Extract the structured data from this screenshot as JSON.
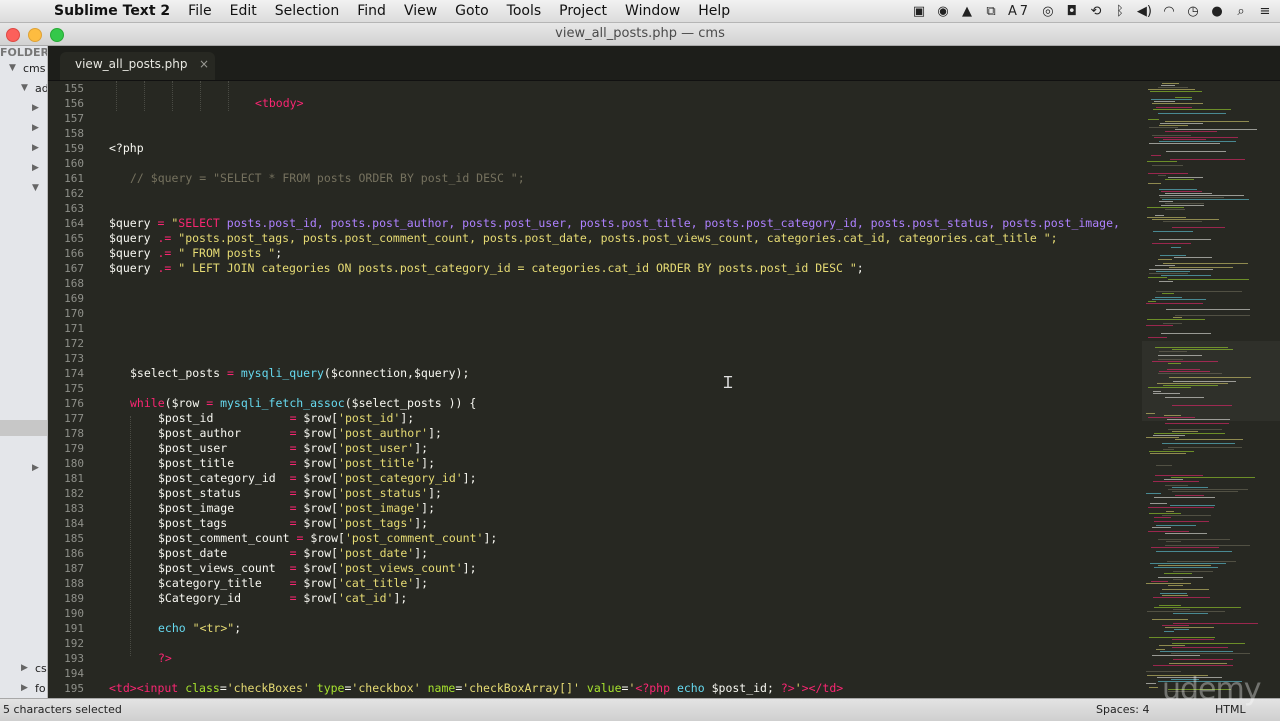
{
  "menubar": {
    "app_name": "Sublime Text 2",
    "items": [
      "File",
      "Edit",
      "Selection",
      "Find",
      "View",
      "Goto",
      "Tools",
      "Project",
      "Window",
      "Help"
    ],
    "tray_icons": [
      "screen-icon",
      "record-icon",
      "drive-icon",
      "share-icon",
      "adobe-icon",
      "cc-icon",
      "cam-icon",
      "timemachine-icon",
      "bluetooth-icon",
      "volume-icon",
      "wifi-icon",
      "clock-icon",
      "user-icon",
      "search-icon",
      "list-icon"
    ],
    "tray_text": "7"
  },
  "window": {
    "title": "view_all_posts.php — cms"
  },
  "sidebar": {
    "heading": "FOLDER",
    "rows": [
      {
        "label": "cms"
      },
      {
        "label": "ad"
      },
      {
        "label": ""
      },
      {
        "label": ""
      },
      {
        "label": ""
      },
      {
        "label": ""
      },
      {
        "label": ""
      },
      {
        "label": "cs"
      },
      {
        "label": "fo"
      }
    ]
  },
  "tab": {
    "label": "view_all_posts.php",
    "close": "×"
  },
  "editor": {
    "lines": [
      {
        "n": "155"
      },
      {
        "n": "156"
      },
      {
        "n": "157"
      },
      {
        "n": "158"
      },
      {
        "n": "159"
      },
      {
        "n": "160"
      },
      {
        "n": "161"
      },
      {
        "n": "162"
      },
      {
        "n": "163"
      },
      {
        "n": "164"
      },
      {
        "n": "165"
      },
      {
        "n": "166"
      },
      {
        "n": "167"
      },
      {
        "n": "168"
      },
      {
        "n": "169"
      },
      {
        "n": "170"
      },
      {
        "n": "171"
      },
      {
        "n": "172"
      },
      {
        "n": "173"
      },
      {
        "n": "174"
      },
      {
        "n": "175"
      },
      {
        "n": "176"
      },
      {
        "n": "177"
      },
      {
        "n": "178"
      },
      {
        "n": "179"
      },
      {
        "n": "180"
      },
      {
        "n": "181"
      },
      {
        "n": "182"
      },
      {
        "n": "183"
      },
      {
        "n": "184"
      },
      {
        "n": "185"
      },
      {
        "n": "186"
      },
      {
        "n": "187"
      },
      {
        "n": "188"
      },
      {
        "n": "189"
      },
      {
        "n": "190"
      },
      {
        "n": "191"
      },
      {
        "n": "192"
      },
      {
        "n": "193"
      },
      {
        "n": "194"
      },
      {
        "n": "195"
      }
    ],
    "code": {
      "l156": "<tbody>",
      "l159": "<?php",
      "l161": "// $query = \"SELECT * FROM posts ORDER BY post_id DESC \";",
      "l164": "$query = \"SELECT posts.post_id, posts.post_author, posts.post_user, posts.post_title, posts.post_category_id, posts.post_status, posts.post_image, ",
      "l165": "$query .= \"posts.post_tags, posts.post_comment_count, posts.post_date, posts.post_views_count, categories.cat_id, categories.cat_title \";",
      "l166": "$query .= \" FROM posts \";",
      "l167": "$query .= \" LEFT JOIN categories ON posts.post_category_id = categories.cat_id ORDER BY posts.post_id DESC \";",
      "l174": "$select_posts = mysqli_query($connection,$query);",
      "l176": "while($row = mysqli_fetch_assoc($select_posts )) {",
      "l177": "$post_id           = $row['post_id'];",
      "l178": "$post_author       = $row['post_author'];",
      "l179": "$post_user         = $row['post_user'];",
      "l180": "$post_title        = $row['post_title'];",
      "l181": "$post_category_id  = $row['post_category_id'];",
      "l182": "$post_status       = $row['post_status'];",
      "l183": "$post_image        = $row['post_image'];",
      "l184": "$post_tags         = $row['post_tags'];",
      "l185": "$post_comment_count = $row['post_comment_count'];",
      "l186": "$post_date         = $row['post_date'];",
      "l187": "$post_views_count  = $row['post_views_count'];",
      "l188": "$category_title    = $row['cat_title'];",
      "l189": "$Category_id       = $row['cat_id'];",
      "l191": "echo \"<tr>\";",
      "l193": "?>",
      "l195": "<td><input class='checkBoxes' type='checkbox' name='checkBoxArray[]' value='<?php echo $post_id; ?>'></td>"
    }
  },
  "statusbar": {
    "selection": "5 characters selected",
    "spaces": "Spaces: 4",
    "syntax": "HTML"
  },
  "watermark": "udemy",
  "colors": {
    "editor_bg": "#272822",
    "keyword": "#f92672",
    "string": "#e6db74",
    "function": "#66d9ef",
    "call": "#a6e22e",
    "comment": "#75715e"
  }
}
